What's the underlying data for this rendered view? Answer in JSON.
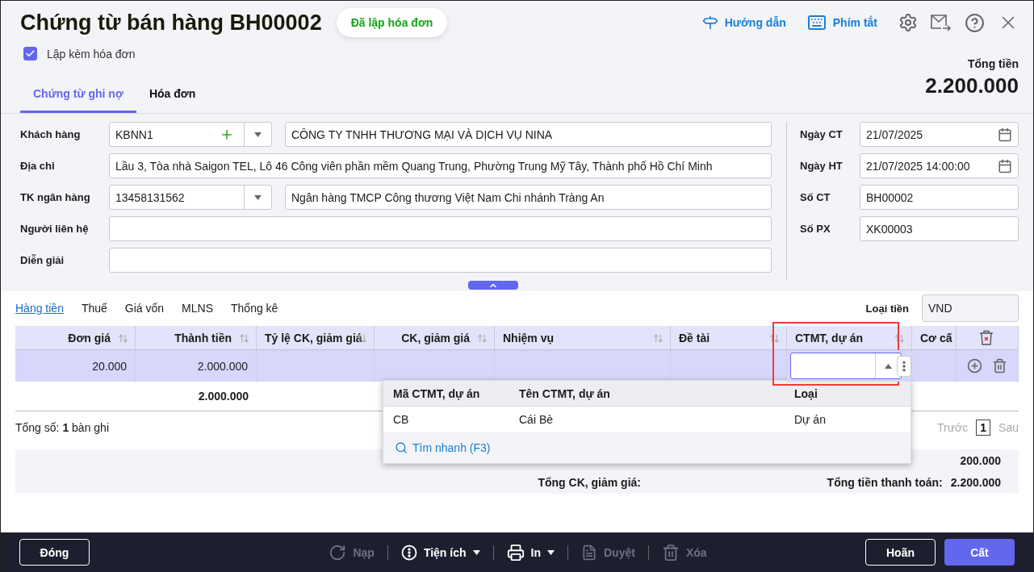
{
  "title": "Chứng từ bán hàng BH00002",
  "status_badge": "Đã lập hóa đơn",
  "header_links": [
    {
      "kind": "guide",
      "label": "Hướng dẫn"
    },
    {
      "kind": "shortcuts",
      "label": "Phím tắt"
    }
  ],
  "invoice_checkbox": {
    "label": "Lập kèm hóa đơn",
    "checked": true
  },
  "tabs": [
    {
      "label": "Chứng từ ghi nợ",
      "selected": true
    },
    {
      "label": "Hóa đơn",
      "selected": false
    }
  ],
  "total": {
    "label": "Tổng tiền",
    "value": "2.200.000"
  },
  "form_left": [
    {
      "kind": "lookup",
      "label": "Khách hàng",
      "code": "KBNN1",
      "add": true,
      "value": "CÔNG TY TNHH THƯƠNG MẠI VÀ DỊCH VỤ NINA"
    },
    {
      "kind": "text",
      "label": "Địa chỉ",
      "value": "Lầu 3, Tòa nhà Saigon TEL, Lô 46 Công viên phần mềm Quang Trung, Phường Trung Mỹ Tây, Thành phố Hồ Chí Minh"
    },
    {
      "kind": "lookup",
      "label": "TK ngân hàng",
      "code": "13458131562",
      "add": false,
      "value": "Ngân hàng TMCP Công thương Việt Nam Chi nhánh Tràng An"
    },
    {
      "kind": "text",
      "label": "Người liên hệ"
    },
    {
      "kind": "text",
      "label": "Diễn giải"
    }
  ],
  "form_right": [
    {
      "kind": "date",
      "label": "Ngày CT",
      "value": "21/07/2025"
    },
    {
      "kind": "date",
      "label": "Ngày HT",
      "value": "21/07/2025 14:00:00"
    },
    {
      "kind": "text",
      "label": "Số CT",
      "value": "BH00002"
    },
    {
      "kind": "text",
      "label": "Số PX",
      "value": "XK00003"
    }
  ],
  "detail_tabs": [
    {
      "label": "Hàng tiền",
      "selected": true
    },
    {
      "label": "Thuế",
      "selected": false
    },
    {
      "label": "Giá vốn",
      "selected": false
    },
    {
      "label": "MLNS",
      "selected": false
    },
    {
      "label": "Thống kê",
      "selected": false
    }
  ],
  "currency": {
    "label": "Loại tiền",
    "value": "VND"
  },
  "grid": {
    "columns": [
      {
        "label": "Đơn giá",
        "numeric": true,
        "sortable": true
      },
      {
        "label": "Thành tiền",
        "numeric": true,
        "sortable": true
      },
      {
        "label": "Tỷ lệ CK, giảm giá",
        "numeric": false,
        "sortable": true
      },
      {
        "label": "CK, giảm giá",
        "numeric": true,
        "sortable": true
      },
      {
        "label": "Nhiệm vụ",
        "numeric": false,
        "sortable": true
      },
      {
        "label": "Đề tài",
        "numeric": false,
        "sortable": true
      },
      {
        "label": "CTMT, dự án",
        "numeric": false,
        "sortable": true
      },
      {
        "label": "Cơ cấ",
        "numeric": false,
        "sortable": false
      }
    ],
    "rows": [
      {
        "selected": true,
        "unit_price": "20.000",
        "amount": "2.000.000"
      }
    ],
    "total_amount": "2.000.000"
  },
  "record_count": "Tổng số: **1** bàn ghi",
  "pagination": {
    "prev": "Trước",
    "page": "1",
    "next": "Sau"
  },
  "summary": {
    "tax_amount": "200.000",
    "discount_label": "Tổng CK, giảm giá:",
    "payment_label": "Tổng tiền thanh toán:",
    "payment_value": "2.200.000"
  },
  "dropdown": {
    "columns": [
      "Mã CTMT, dự án",
      "Tên CTMT, dự án",
      "Loại"
    ],
    "rows": [
      [
        "CB",
        "Cái Bè",
        "Dự án"
      ]
    ],
    "quick_search": "Tìm nhanh (F3)"
  },
  "footer": {
    "close": "Đóng",
    "actions": [
      {
        "kind": "reload",
        "label": "Nạp",
        "disabled": true,
        "menu": false
      },
      {
        "kind": "utilities",
        "label": "Tiện ích",
        "disabled": false,
        "menu": true
      },
      {
        "kind": "print",
        "label": "In",
        "disabled": false,
        "menu": true
      },
      {
        "kind": "approve",
        "label": "Duyệt",
        "disabled": true,
        "menu": false
      },
      {
        "kind": "delete",
        "label": "Xóa",
        "disabled": true,
        "menu": false
      }
    ],
    "cancel": "Hoãn",
    "save": "Cất"
  }
}
